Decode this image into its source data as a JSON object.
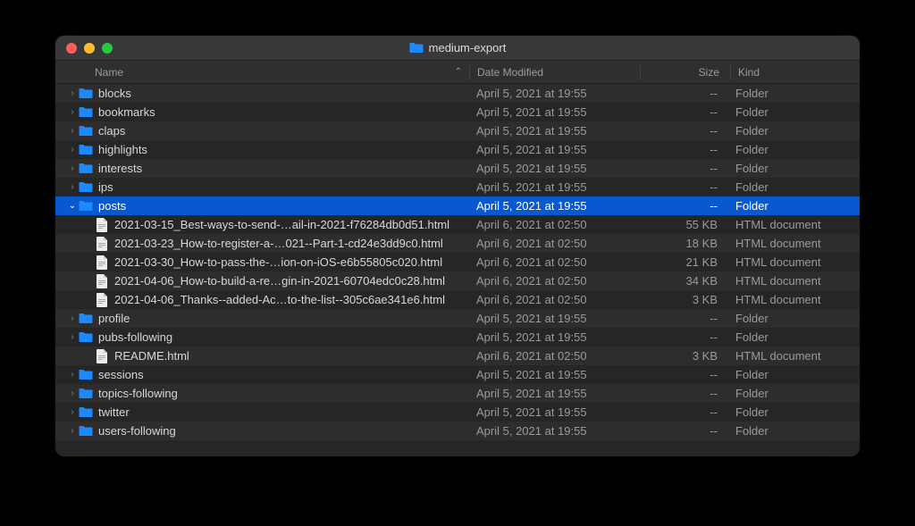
{
  "window": {
    "title": "medium-export"
  },
  "columns": {
    "name": "Name",
    "date": "Date Modified",
    "size": "Size",
    "kind": "Kind"
  },
  "rows": [
    {
      "indent": 0,
      "disclosure": "right",
      "icon": "folder",
      "name": "blocks",
      "date": "April 5, 2021 at 19:55",
      "size": "--",
      "kind": "Folder",
      "selected": false
    },
    {
      "indent": 0,
      "disclosure": "right",
      "icon": "folder",
      "name": "bookmarks",
      "date": "April 5, 2021 at 19:55",
      "size": "--",
      "kind": "Folder",
      "selected": false
    },
    {
      "indent": 0,
      "disclosure": "right",
      "icon": "folder",
      "name": "claps",
      "date": "April 5, 2021 at 19:55",
      "size": "--",
      "kind": "Folder",
      "selected": false
    },
    {
      "indent": 0,
      "disclosure": "right",
      "icon": "folder",
      "name": "highlights",
      "date": "April 5, 2021 at 19:55",
      "size": "--",
      "kind": "Folder",
      "selected": false
    },
    {
      "indent": 0,
      "disclosure": "right",
      "icon": "folder",
      "name": "interests",
      "date": "April 5, 2021 at 19:55",
      "size": "--",
      "kind": "Folder",
      "selected": false
    },
    {
      "indent": 0,
      "disclosure": "right",
      "icon": "folder",
      "name": "ips",
      "date": "April 5, 2021 at 19:55",
      "size": "--",
      "kind": "Folder",
      "selected": false
    },
    {
      "indent": 0,
      "disclosure": "down",
      "icon": "folder",
      "name": "posts",
      "date": "April 5, 2021 at 19:55",
      "size": "--",
      "kind": "Folder",
      "selected": true
    },
    {
      "indent": 1,
      "disclosure": "none",
      "icon": "file",
      "name": "2021-03-15_Best-ways-to-send-…ail-in-2021-f76284db0d51.html",
      "date": "April 6, 2021 at 02:50",
      "size": "55 KB",
      "kind": "HTML document",
      "selected": false
    },
    {
      "indent": 1,
      "disclosure": "none",
      "icon": "file",
      "name": "2021-03-23_How-to-register-a-…021--Part-1-cd24e3dd9c0.html",
      "date": "April 6, 2021 at 02:50",
      "size": "18 KB",
      "kind": "HTML document",
      "selected": false
    },
    {
      "indent": 1,
      "disclosure": "none",
      "icon": "file",
      "name": "2021-03-30_How-to-pass-the-…ion-on-iOS-e6b55805c020.html",
      "date": "April 6, 2021 at 02:50",
      "size": "21 KB",
      "kind": "HTML document",
      "selected": false
    },
    {
      "indent": 1,
      "disclosure": "none",
      "icon": "file",
      "name": "2021-04-06_How-to-build-a-re…gin-in-2021-60704edc0c28.html",
      "date": "April 6, 2021 at 02:50",
      "size": "34 KB",
      "kind": "HTML document",
      "selected": false
    },
    {
      "indent": 1,
      "disclosure": "none",
      "icon": "file",
      "name": "2021-04-06_Thanks--added-Ac…to-the-list--305c6ae341e6.html",
      "date": "April 6, 2021 at 02:50",
      "size": "3 KB",
      "kind": "HTML document",
      "selected": false
    },
    {
      "indent": 0,
      "disclosure": "right",
      "icon": "folder",
      "name": "profile",
      "date": "April 5, 2021 at 19:55",
      "size": "--",
      "kind": "Folder",
      "selected": false
    },
    {
      "indent": 0,
      "disclosure": "right",
      "icon": "folder",
      "name": "pubs-following",
      "date": "April 5, 2021 at 19:55",
      "size": "--",
      "kind": "Folder",
      "selected": false
    },
    {
      "indent": 1,
      "disclosure": "none",
      "icon": "file",
      "name": "README.html",
      "date": "April 6, 2021 at 02:50",
      "size": "3 KB",
      "kind": "HTML document",
      "selected": false
    },
    {
      "indent": 0,
      "disclosure": "right",
      "icon": "folder",
      "name": "sessions",
      "date": "April 5, 2021 at 19:55",
      "size": "--",
      "kind": "Folder",
      "selected": false
    },
    {
      "indent": 0,
      "disclosure": "right",
      "icon": "folder",
      "name": "topics-following",
      "date": "April 5, 2021 at 19:55",
      "size": "--",
      "kind": "Folder",
      "selected": false
    },
    {
      "indent": 0,
      "disclosure": "right",
      "icon": "folder",
      "name": "twitter",
      "date": "April 5, 2021 at 19:55",
      "size": "--",
      "kind": "Folder",
      "selected": false
    },
    {
      "indent": 0,
      "disclosure": "right",
      "icon": "folder",
      "name": "users-following",
      "date": "April 5, 2021 at 19:55",
      "size": "--",
      "kind": "Folder",
      "selected": false
    }
  ]
}
